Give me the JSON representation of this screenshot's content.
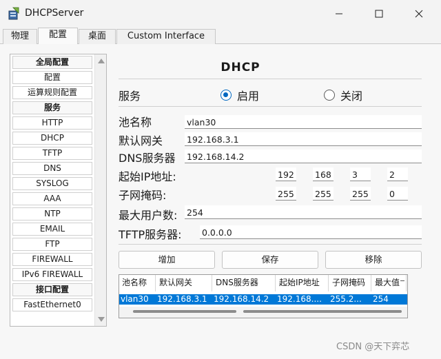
{
  "window": {
    "title": "DHCPServer",
    "icon": "packet-tracer-server-icon"
  },
  "tabs": [
    {
      "label": "物理",
      "active": false
    },
    {
      "label": "配置",
      "active": true
    },
    {
      "label": "桌面",
      "active": false
    },
    {
      "label": "Custom Interface",
      "active": false
    }
  ],
  "sidebar": {
    "items": [
      {
        "label": "全局配置",
        "type": "header"
      },
      {
        "label": "配置",
        "type": "item"
      },
      {
        "label": "运算规则配置",
        "type": "item"
      },
      {
        "label": "服务",
        "type": "header"
      },
      {
        "label": "HTTP",
        "type": "item"
      },
      {
        "label": "DHCP",
        "type": "item"
      },
      {
        "label": "TFTP",
        "type": "item"
      },
      {
        "label": "DNS",
        "type": "item"
      },
      {
        "label": "SYSLOG",
        "type": "item"
      },
      {
        "label": "AAA",
        "type": "item"
      },
      {
        "label": "NTP",
        "type": "item"
      },
      {
        "label": "EMAIL",
        "type": "item"
      },
      {
        "label": "FTP",
        "type": "item"
      },
      {
        "label": "FIREWALL",
        "type": "item"
      },
      {
        "label": "IPv6 FIREWALL",
        "type": "item"
      },
      {
        "label": "接口配置",
        "type": "header"
      },
      {
        "label": "FastEthernet0",
        "type": "item"
      }
    ]
  },
  "dhcp": {
    "title": "DHCP",
    "service_label": "服务",
    "on_label": "启用",
    "off_label": "关闭",
    "service_on": true,
    "pool_name_label": "池名称",
    "pool_name": "vlan30",
    "gateway_label": "默认网关",
    "gateway": "192.168.3.1",
    "dns_label": "DNS服务器",
    "dns": "192.168.14.2",
    "start_ip_label": "起始IP地址:",
    "start_ip": [
      "192",
      "168",
      "3",
      "2"
    ],
    "mask_label": "子网掩码:",
    "mask": [
      "255",
      "255",
      "255",
      "0"
    ],
    "max_users_label": "最大用户数:",
    "max_users": "254",
    "tftp_label": "TFTP服务器:",
    "tftp": "0.0.0.0",
    "add_label": "增加",
    "save_label": "保存",
    "remove_label": "移除"
  },
  "pool_table": {
    "columns": [
      "池名称",
      "默认网关",
      "DNS服务器",
      "起始IP地址",
      "子网掩码",
      "最大值"
    ],
    "rows": [
      [
        "vlan30",
        "192.168.3.1",
        "192.168.14.2",
        "192.168....",
        "255.2...",
        "254"
      ]
    ]
  },
  "watermark": "CSDN @天下弈芯",
  "colors": {
    "selection": "#0078d7",
    "radio": "#0067c0"
  }
}
